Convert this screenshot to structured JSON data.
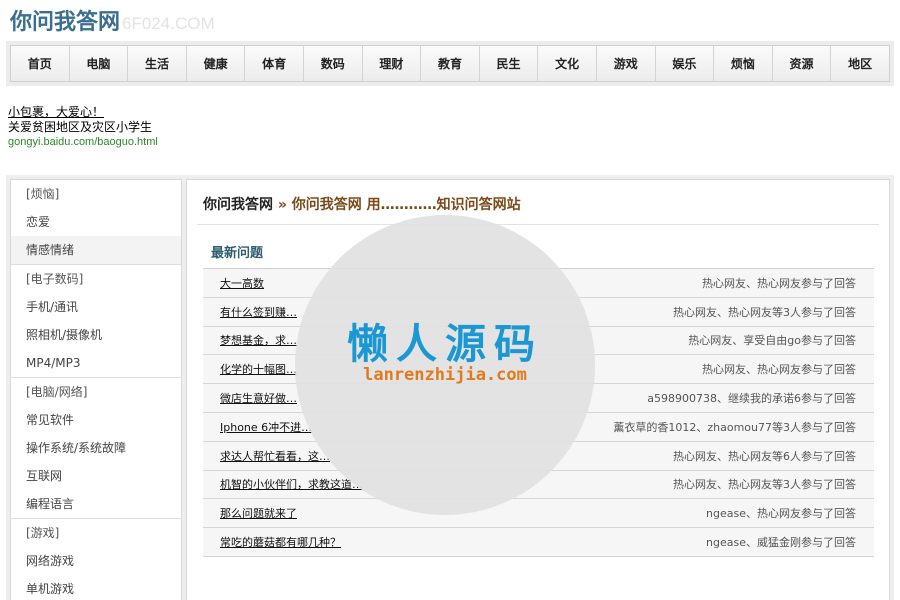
{
  "header": {
    "logo_text": "你问我答网",
    "logo_domain": "6F024.COM"
  },
  "nav": {
    "items": [
      "首页",
      "电脑",
      "生活",
      "健康",
      "体育",
      "数码",
      "理财",
      "教育",
      "民生",
      "文化",
      "游戏",
      "娱乐",
      "烦恼",
      "资源",
      "地区"
    ]
  },
  "ad": {
    "line1": "小包裹，大爱心！",
    "line2": "关爱贫困地区及灾区小学生",
    "url": "gongyi.baidu.com/baoguo.html"
  },
  "sidebar": {
    "groups": [
      {
        "category": "[烦恼]",
        "items": [
          "恋爱",
          "情感情绪"
        ]
      },
      {
        "category": "[电子数码]",
        "items": [
          "手机/通讯",
          "照相机/摄像机",
          "MP4/MP3"
        ]
      },
      {
        "category": "[电脑/网络]",
        "items": [
          "常见软件",
          "操作系统/系统故障",
          "互联网",
          "编程语言"
        ]
      },
      {
        "category": "[游戏]",
        "items": [
          "网络游戏",
          "单机游戏"
        ]
      }
    ],
    "active_item": "情感情绪"
  },
  "main": {
    "breadcrumb": {
      "site": "你问我答网",
      "separator": "»",
      "current": "你问我答网 用…………知识问答网站"
    },
    "section_title": "最新问题",
    "questions": [
      {
        "title": "大一高数",
        "meta": "热心网友、热心网友参与了回答"
      },
      {
        "title": "有什么签到赚…",
        "meta": "热心网友、热心网友等3人参与了回答"
      },
      {
        "title": "梦想基金，求…",
        "meta": "热心网友、享受自由go参与了回答"
      },
      {
        "title": "化学的十幅图…",
        "meta": "热心网友、热心网友参与了回答"
      },
      {
        "title": "微店生意好做…",
        "meta": "a598900738、继续我的承诺6参与了回答"
      },
      {
        "title": "Iphone 6冲不进…",
        "meta": "薰衣草的香1012、zhaomou77等3人参与了回答"
      },
      {
        "title": "求达人帮忙看看，这…",
        "meta": "热心网友、热心网友等6人参与了回答"
      },
      {
        "title": "机智的小伙伴们，求教这道…",
        "meta": "热心网友、热心网友等3人参与了回答"
      },
      {
        "title": "那么问题就来了",
        "meta": "ngease、热心网友参与了回答"
      },
      {
        "title": "常吃的蘑菇都有哪几种？",
        "meta": "ngease、威猛金刚参与了回答"
      }
    ]
  },
  "watermark": {
    "text": "懒人源码",
    "url": "lanrenzhijia.com"
  },
  "colors": {
    "logo": "#3a6f8f",
    "breadcrumb_current": "#7a4a1a",
    "section_title": "#2f5e72",
    "ad_url": "#2a8a2a",
    "watermark_text": "#1b97d4",
    "watermark_url": "#e07a1c"
  }
}
